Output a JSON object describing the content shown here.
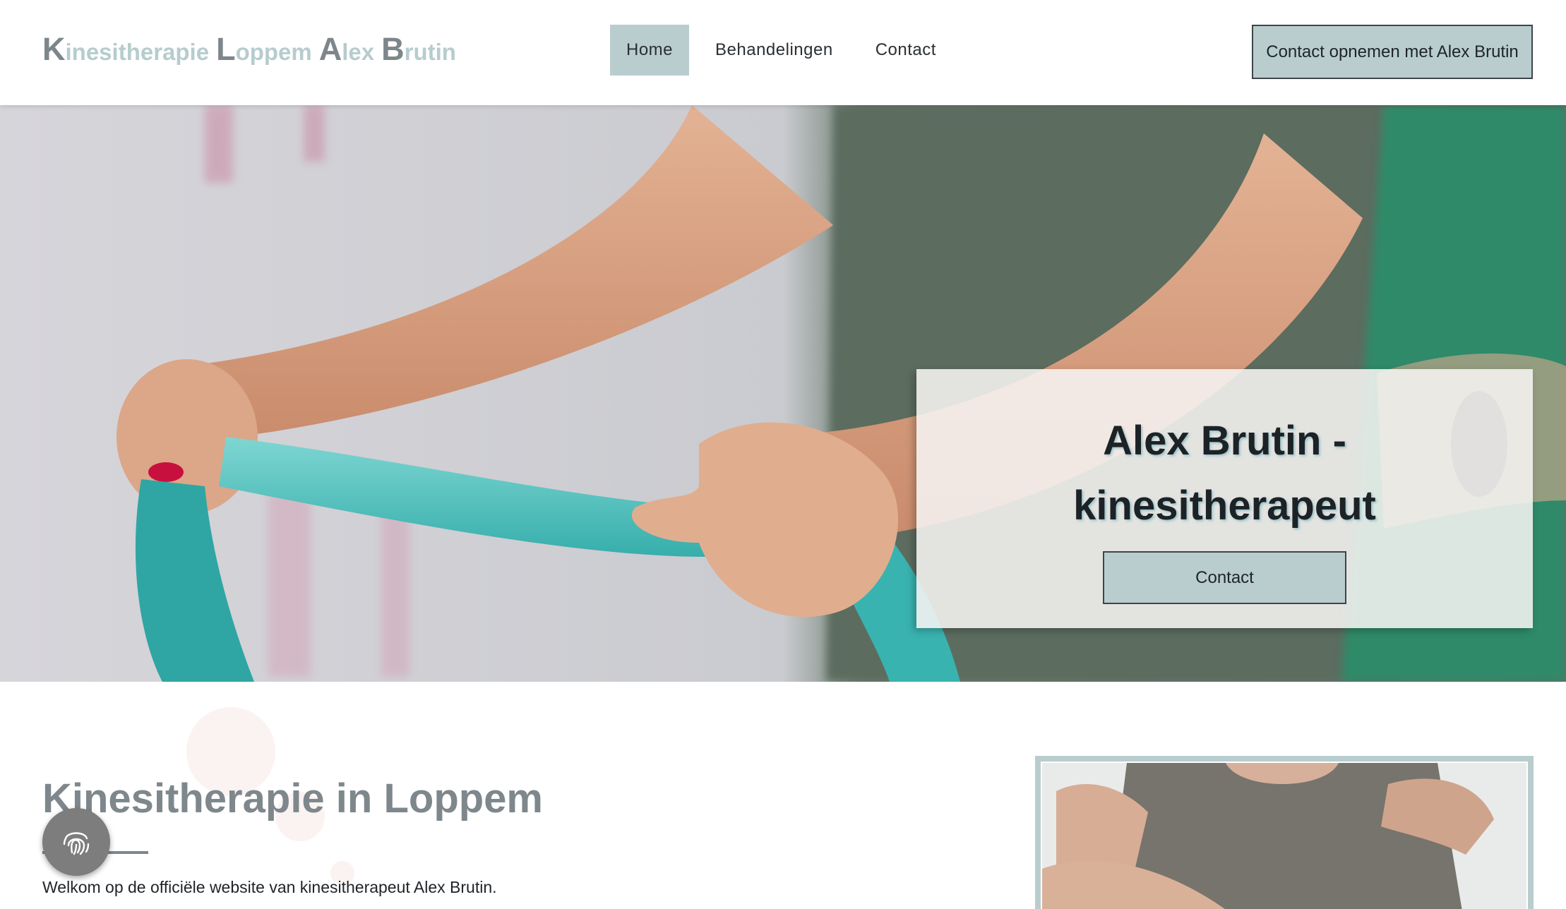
{
  "brand": {
    "words": [
      {
        "initial": "K",
        "rest": "inesitherapie"
      },
      {
        "initial": "L",
        "rest": "oppem"
      },
      {
        "initial": "A",
        "rest": "lex"
      },
      {
        "initial": "B",
        "rest": "rutin"
      }
    ]
  },
  "nav": {
    "items": [
      {
        "label": "Home",
        "active": true
      },
      {
        "label": "Behandelingen",
        "active": false
      },
      {
        "label": "Contact",
        "active": false
      }
    ]
  },
  "header": {
    "cta_label": "Contact opnemen met Alex Brutin"
  },
  "hero": {
    "title_line1": "Alex Brutin -",
    "title_line2": "kinesitherapeut",
    "button_label": "Contact"
  },
  "intro": {
    "title": "Kinesitherapie in Loppem",
    "text": "Welkom op de officiële website van kinesitherapeut Alex Brutin."
  },
  "colors": {
    "accent": "#b9cdcf",
    "brand_gray": "#7d868b",
    "brand_light": "#b6ccce",
    "heading_gray": "#7e878c",
    "border_dark": "#3e4549"
  },
  "icons": {
    "consent": "fingerprint-icon"
  }
}
